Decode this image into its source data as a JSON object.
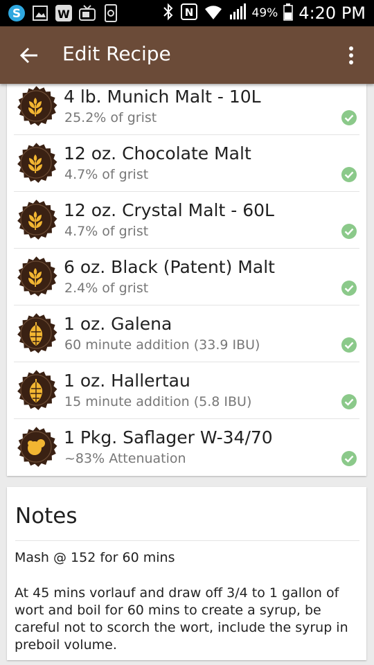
{
  "status_bar": {
    "icons": [
      "skype-icon",
      "gallery-icon",
      "word-icon",
      "tv-icon",
      "phone-icon",
      "bluetooth-icon",
      "nfc-icon",
      "wifi-icon",
      "signal-icon",
      "battery-icon"
    ],
    "word_letter": "W",
    "nfc_letter": "N",
    "battery": "49%",
    "time": "4:20 PM"
  },
  "app_bar": {
    "title": "Edit Recipe",
    "back_icon": "arrow-back-icon",
    "menu_icon": "more-vert-icon"
  },
  "colors": {
    "app_bar": "#6b4b38",
    "badge_bg": "#3a2113",
    "badge_icon": "#f2b632",
    "check": "#8bc98a"
  },
  "ingredients": [
    {
      "name": "4 lb. Munich Malt - 10L",
      "detail": "25.2% of grist",
      "icon": "grain-icon",
      "done": true
    },
    {
      "name": "12 oz. Chocolate Malt",
      "detail": "4.7% of grist",
      "icon": "grain-icon",
      "done": true
    },
    {
      "name": "12 oz. Crystal Malt - 60L",
      "detail": "4.7% of grist",
      "icon": "grain-icon",
      "done": true
    },
    {
      "name": "6 oz. Black (Patent) Malt",
      "detail": "2.4% of grist",
      "icon": "grain-icon",
      "done": true
    },
    {
      "name": "1 oz. Galena",
      "detail": "60 minute addition (33.9 IBU)",
      "icon": "hop-icon",
      "done": true
    },
    {
      "name": "1 oz. Hallertau",
      "detail": "15 minute addition (5.8 IBU)",
      "icon": "hop-icon",
      "done": true
    },
    {
      "name": "1 Pkg. Saflager W-34/70",
      "detail": "~83% Attenuation",
      "icon": "yeast-icon",
      "done": true
    }
  ],
  "notes": {
    "title": "Notes",
    "line1": "Mash @ 152 for 60 mins",
    "paragraph": "At 45 mins vorlauf and draw off 3/4 to 1 gallon of wort and boil for 60 mins to create a syrup, be careful not to scorch the wort, include the syrup in preboil volume."
  }
}
